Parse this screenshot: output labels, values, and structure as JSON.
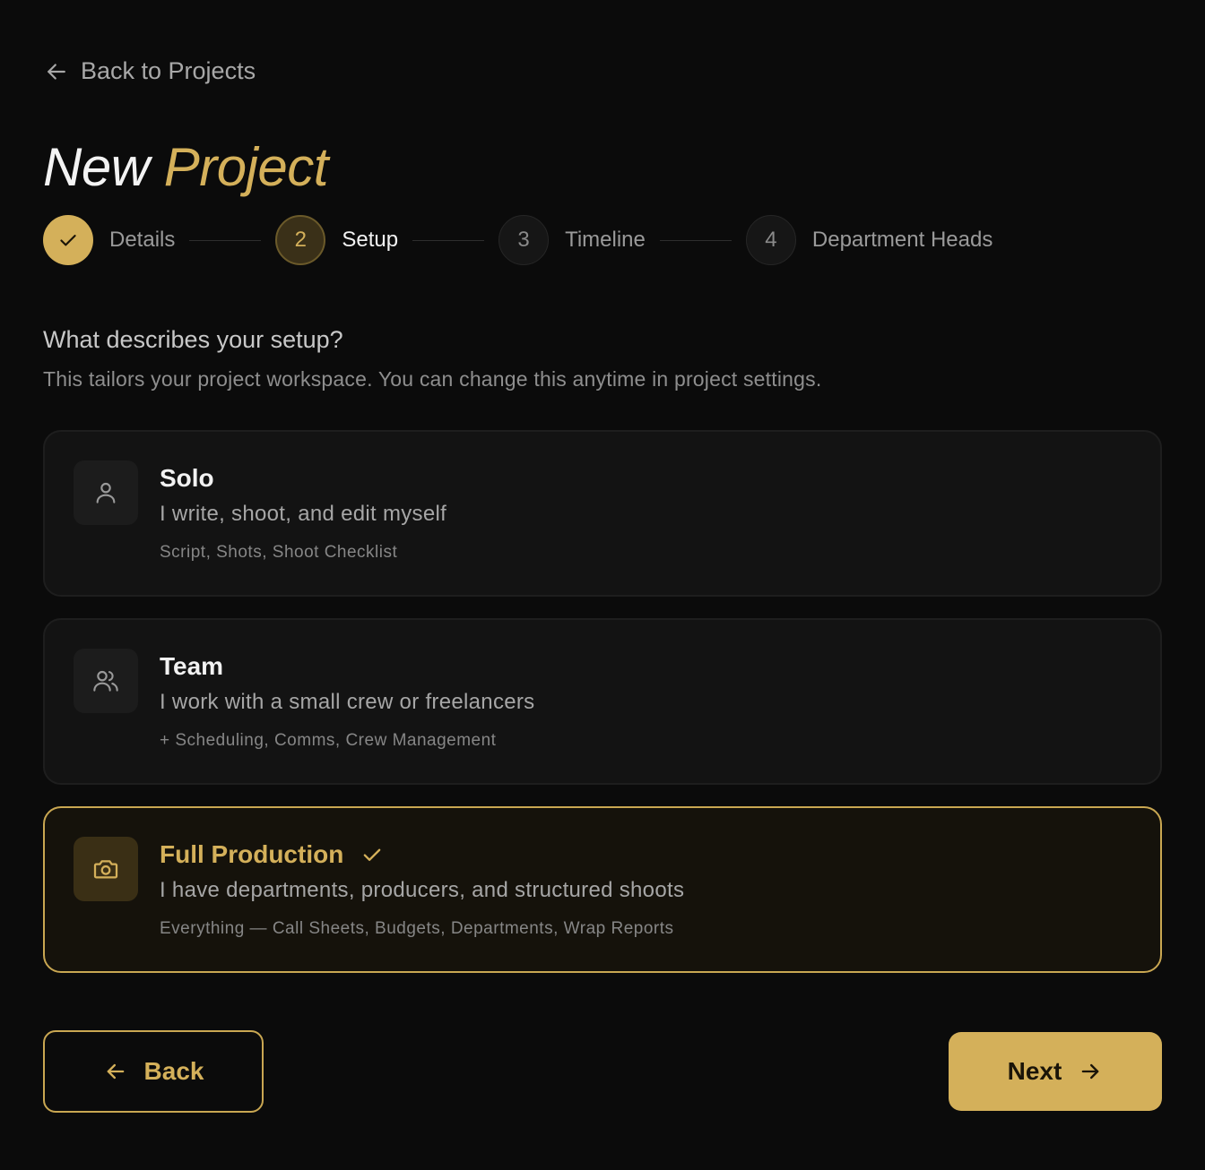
{
  "nav": {
    "back_label": "Back to Projects"
  },
  "title": {
    "part1": "New ",
    "part2": "Project"
  },
  "steps": [
    {
      "number": "1",
      "label": "Details",
      "state": "done"
    },
    {
      "number": "2",
      "label": "Setup",
      "state": "active"
    },
    {
      "number": "3",
      "label": "Timeline",
      "state": "pending"
    },
    {
      "number": "4",
      "label": "Department Heads",
      "state": "pending"
    }
  ],
  "question": "What describes your setup?",
  "subtext": "This tailors your project workspace. You can change this anytime in project settings.",
  "options": [
    {
      "title": "Solo",
      "description": "I write, shoot, and edit myself",
      "features": "Script, Shots, Shoot Checklist",
      "icon": "user-icon",
      "selected": false
    },
    {
      "title": "Team",
      "description": "I work with a small crew or freelancers",
      "features": "+ Scheduling, Comms, Crew Management",
      "icon": "users-icon",
      "selected": false
    },
    {
      "title": "Full Production",
      "description": "I have departments, producers, and structured shoots",
      "features": "Everything — Call Sheets, Budgets, Departments, Wrap Reports",
      "icon": "camera-icon",
      "selected": true
    }
  ],
  "buttons": {
    "back": "Back",
    "next": "Next"
  },
  "colors": {
    "accent": "#d4b05a",
    "background": "#0b0b0b",
    "card": "#131313"
  }
}
